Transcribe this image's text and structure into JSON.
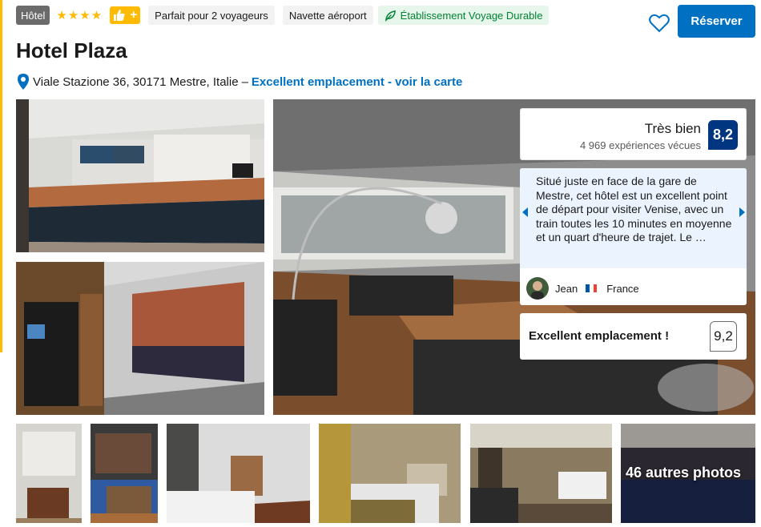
{
  "header": {
    "type_badge": "Hôtel",
    "stars": 4,
    "chips": [
      "Parfait pour 2 voyageurs",
      "Navette aéroport"
    ],
    "sustainable_label": "Établissement Voyage Durable",
    "reserve_label": "Réserver",
    "title": "Hotel Plaza"
  },
  "address": {
    "text": "Viale Stazione 36, 30171 Mestre, Italie",
    "separator": "–",
    "link": "Excellent emplacement - voir la carte"
  },
  "rating": {
    "word": "Très bien",
    "count": "4 969 expériences vécues",
    "score": "8,2"
  },
  "review": {
    "text": "Situé juste en face de la gare de Mestre, cet hôtel est un excellent point de départ pour visiter Venise, avec un train toutes les 10 minutes en moyenne et un quart d'heure de trajet. Le …",
    "author": "Jean",
    "country": "France"
  },
  "location": {
    "label": "Excellent emplacement !",
    "score": "9,2"
  },
  "gallery": {
    "more_label": "46 autres photos"
  },
  "colors": {
    "primary": "#0071c2",
    "score_bg": "#003580",
    "star": "#febb02",
    "green": "#008234"
  }
}
